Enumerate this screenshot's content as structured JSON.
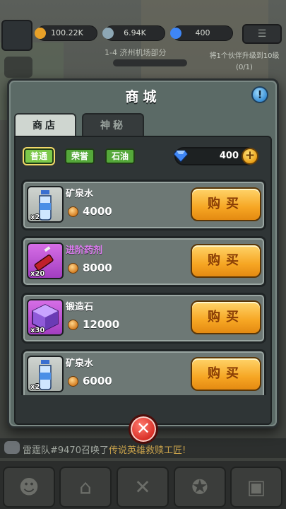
{
  "hud": {
    "coins": "100.22K",
    "elixir": "6.94K",
    "gems": "400",
    "stage": "1-4 济州机场部分",
    "task": "将1个伙伴升级到10级(0/1)"
  },
  "chat": {
    "prefix": "雷霆队#9470召唤了",
    "highlight": "传说英雄救赎工匠!"
  },
  "dialog": {
    "title": "商城",
    "info_label": "!",
    "tabs": [
      {
        "label": "商店",
        "active": true
      },
      {
        "label": "神秘",
        "active": false
      }
    ],
    "filters": [
      {
        "label": "普通",
        "selected": true
      },
      {
        "label": "荣誉",
        "selected": false
      },
      {
        "label": "石油",
        "selected": false
      }
    ],
    "gem_balance": "400",
    "gem_plus": "+",
    "items": [
      {
        "name": "矿泉水",
        "qty": "x2",
        "price": "4000",
        "rarity": "normal",
        "buy_label": "购买"
      },
      {
        "name": "进阶药剂",
        "qty": "x20",
        "price": "8000",
        "rarity": "epic",
        "buy_label": "购买"
      },
      {
        "name": "锻造石",
        "qty": "x30",
        "price": "12000",
        "rarity": "normal",
        "buy_label": "购买"
      },
      {
        "name": "矿泉水",
        "qty": "x2",
        "price": "6000",
        "rarity": "normal",
        "buy_label": "购买"
      }
    ],
    "close_label": "✕"
  },
  "colors": {
    "gem": "#3f86f5",
    "coin": "#e89c12",
    "epic": "#e07cf3",
    "buy_button": "#f6a623",
    "close_button": "#d62a22",
    "filter_green": "#55a83a"
  }
}
